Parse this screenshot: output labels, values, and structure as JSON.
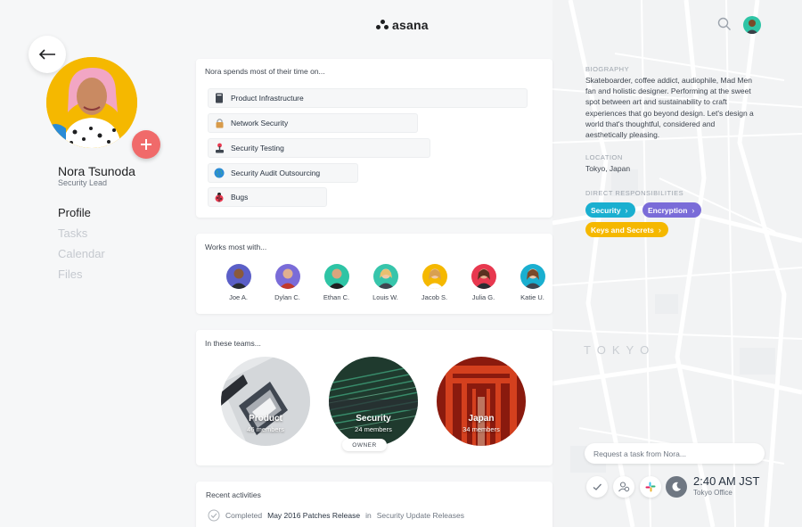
{
  "app": {
    "logo_text": "asana"
  },
  "profile": {
    "name": "Nora Tsunoda",
    "role": "Security Lead"
  },
  "nav": {
    "items": [
      {
        "label": "Profile",
        "active": true
      },
      {
        "label": "Tasks",
        "active": false
      },
      {
        "label": "Calendar",
        "active": false
      },
      {
        "label": "Files",
        "active": false
      }
    ]
  },
  "time_on": {
    "title": "Nora spends most of their time on...",
    "projects": [
      {
        "label": "Product Infrastructure",
        "icon": "book-icon"
      },
      {
        "label": "Network Security",
        "icon": "lock-icon"
      },
      {
        "label": "Security Testing",
        "icon": "joystick-icon"
      },
      {
        "label": "Security Audit Outsourcing",
        "icon": "globe-icon"
      },
      {
        "label": "Bugs",
        "icon": "ladybug-icon"
      }
    ]
  },
  "works_with": {
    "title": "Works most with...",
    "people": [
      {
        "name": "Joe A.",
        "color": "#5b5fc7"
      },
      {
        "name": "Dylan C.",
        "color": "#7a6cd8"
      },
      {
        "name": "Ethan C.",
        "color": "#2ec4a5"
      },
      {
        "name": "Louis W.",
        "color": "#37c5ab"
      },
      {
        "name": "Jacob S.",
        "color": "#f5b800"
      },
      {
        "name": "Julia G.",
        "color": "#e8384f"
      },
      {
        "name": "Katie U.",
        "color": "#1aafd0"
      }
    ]
  },
  "teams": {
    "title": "In these teams...",
    "items": [
      {
        "name": "Product",
        "members": "46 members"
      },
      {
        "name": "Security",
        "members": "24 members"
      },
      {
        "name": "Japan",
        "members": "34 members"
      }
    ],
    "owner_label": "OWNER"
  },
  "activities": {
    "title": "Recent activities",
    "items": [
      {
        "verb": "Completed",
        "task": "May 2016 Patches Release",
        "connector": "in",
        "project": "Security Update Releases"
      }
    ]
  },
  "biography": {
    "label": "BIOGRAPHY",
    "text": "Skateboarder, coffee addict, audiophile, Mad Men fan and holistic designer. Performing at the sweet spot between art and sustainability to craft experiences that go beyond design. Let's design a world that's thoughtful, considered and aesthetically pleasing."
  },
  "location": {
    "label": "LOCATION",
    "text": "Tokyo, Japan"
  },
  "responsibilities": {
    "label": "DIRECT RESPONSIBILITIES",
    "chips": [
      {
        "label": "Security",
        "color": "#1aafd0"
      },
      {
        "label": "Encryption",
        "color": "#7a6cd8"
      },
      {
        "label": "Keys and Secrets",
        "color": "#f5b800"
      }
    ]
  },
  "map": {
    "city_label": "TOKYO"
  },
  "request": {
    "placeholder": "Request a task from Nora..."
  },
  "clock": {
    "time": "2:40 AM JST",
    "office": "Tokyo Office"
  },
  "colors": {
    "accent_red": "#f06a6a",
    "text": "#273240"
  }
}
